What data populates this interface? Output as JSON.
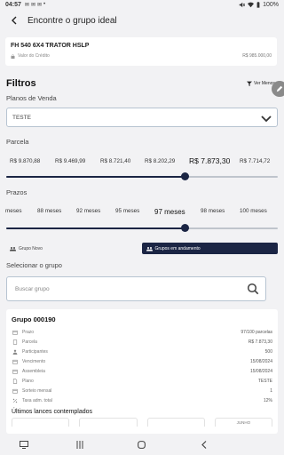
{
  "status_bar": {
    "time": "04:57",
    "notifications": [
      "✉",
      "✉",
      "✉",
      "•"
    ],
    "battery": "100%"
  },
  "app_bar": {
    "title": "Encontre o grupo ideal"
  },
  "vehicle": {
    "name": "FH 540 6X4 TRATOR HSLP",
    "credit_label": "Valor do Crédito",
    "credit_value": "R$ 985.000,00"
  },
  "filters": {
    "title": "Filtros",
    "toggle_label": "Ver Menos",
    "plano_label": "Planos de Venda",
    "plano_value": "TESTE",
    "parcela_label": "Parcela",
    "parcela_options": [
      "R$ 9.870,88",
      "R$ 9.469,99",
      "R$ 8.721,40",
      "R$ 8.202,29",
      "R$ 7.873,30",
      "R$ 7.714,72"
    ],
    "parcela_selected_index": 4,
    "parcela_slider_fraction": 0.66,
    "prazos_label": "Prazos",
    "prazo_options": [
      "meses",
      "88 meses",
      "92 meses",
      "95 meses",
      "97 meses",
      "98 meses",
      "100 meses"
    ],
    "prazo_selected_index": 4,
    "prazo_slider_fraction": 0.66,
    "group_toggle": {
      "new": "Grupo Novo",
      "ongoing": "Grupos em andamento",
      "selected": "ongoing"
    },
    "grupo_label": "Selecionar o grupo",
    "search_placeholder": "Buscar grupo"
  },
  "group": {
    "title": "Grupo 000190",
    "rows": [
      {
        "icon": "calendar-icon",
        "label": "Prazo",
        "value": "97/100 parcelas"
      },
      {
        "icon": "receipt-icon",
        "label": "Parcela",
        "value": "R$ 7.873,30"
      },
      {
        "icon": "person-icon",
        "label": "Participantes",
        "value": "500"
      },
      {
        "icon": "calendar-icon",
        "label": "Vencimento",
        "value": "15/08/2024"
      },
      {
        "icon": "calendar-icon",
        "label": "Assembleia",
        "value": "15/08/2024"
      },
      {
        "icon": "document-icon",
        "label": "Plano",
        "value": "TESTE"
      },
      {
        "icon": "calendar-icon",
        "label": "Sorteio mensal",
        "value": "1"
      },
      {
        "icon": "percent-icon",
        "label": "Taxa adm. total",
        "value": "12%"
      }
    ],
    "lances_title": "Últimos lances contemplados",
    "lance_boxes": [
      "",
      "",
      "",
      "JUNHO"
    ]
  },
  "colors": {
    "accent": "#1b2544",
    "background": "#f2f2f4"
  }
}
